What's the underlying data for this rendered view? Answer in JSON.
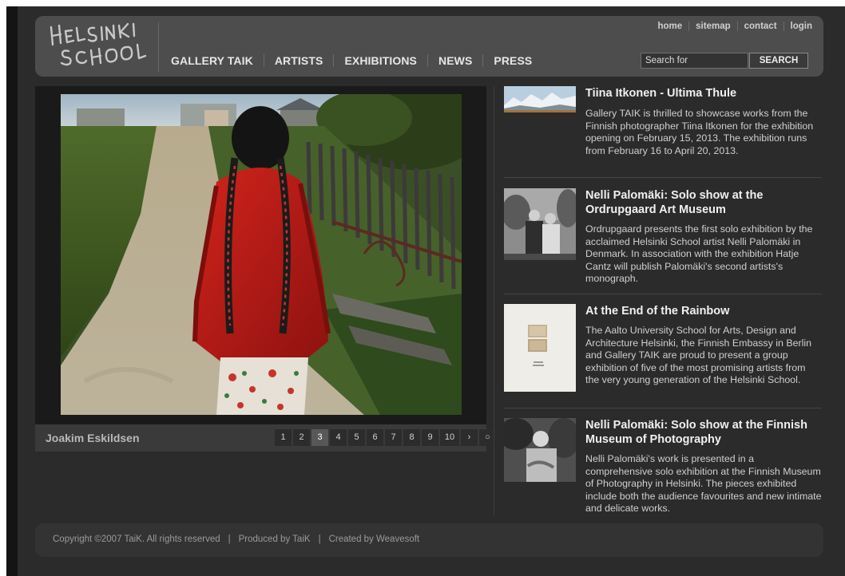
{
  "brand": {
    "logo_text_line1": "HELSINKI",
    "logo_text_line2": "SCHOOL"
  },
  "top_nav": [
    "home",
    "sitemap",
    "contact",
    "login"
  ],
  "main_nav": [
    "GALLERY TAIK",
    "ARTISTS",
    "EXHIBITIONS",
    "NEWS",
    "PRESS"
  ],
  "search": {
    "placeholder": "Search for",
    "button_label": "SEARCH"
  },
  "slideshow": {
    "photographer": "Joakim Eskildsen",
    "pages": [
      "1",
      "2",
      "3",
      "4",
      "5",
      "6",
      "7",
      "8",
      "9",
      "10"
    ],
    "active_page": "3",
    "next_label": "›",
    "play_icon": "○"
  },
  "news": [
    {
      "title": "Tiina Itkonen - Ultima Thule",
      "text": "Gallery TAIK is thrilled to showcase works from the Finnish photographer Tiina Itkonen for the exhibition opening on February 15, 2013. The exhibition runs from February 16 to April 20, 2013.",
      "thumb_icon": "mountain-landscape-thumbnail"
    },
    {
      "title": "Nelli Palomäki: Solo show at the Ordrupgaard Art Museum",
      "text": "Ordrupgaard presents the first solo exhibition by the acclaimed Helsinki School artist Nelli Palomäki in Denmark. In association with the exhibition Hatje Cantz will publish Palomäki's second artists's monograph.",
      "thumb_icon": "couple-portrait-thumbnail"
    },
    {
      "title": "At the End of the Rainbow",
      "text": "The Aalto University School for Arts, Design and Architecture Helsinki, the Finnish Embassy in Berlin and Gallery TAIK are proud to present a group exhibition of five of the most promising artists from the very young generation of the Helsinki School.",
      "thumb_icon": "catalogue-cover-thumbnail"
    },
    {
      "title": "Nelli Palomäki: Solo show at the Finnish Museum of Photography",
      "text": "Nelli Palomäki's work is presented in a comprehensive solo exhibition at the Finnish Museum of Photography in Helsinki. The pieces exhibited include both the audience favourites and new intimate and delicate works.",
      "thumb_icon": "man-portrait-thumbnail"
    }
  ],
  "footer": {
    "copyright": "Copyright ©2007 TaiK. All rights reserved",
    "produced": "Produced by TaiK",
    "created": "Created by Weavesoft"
  },
  "colors": {
    "page_bg": "#2b2b2b",
    "header_bg": "#4d4d4d",
    "footer_bg": "#333333",
    "dress_red": "#b51a16"
  }
}
